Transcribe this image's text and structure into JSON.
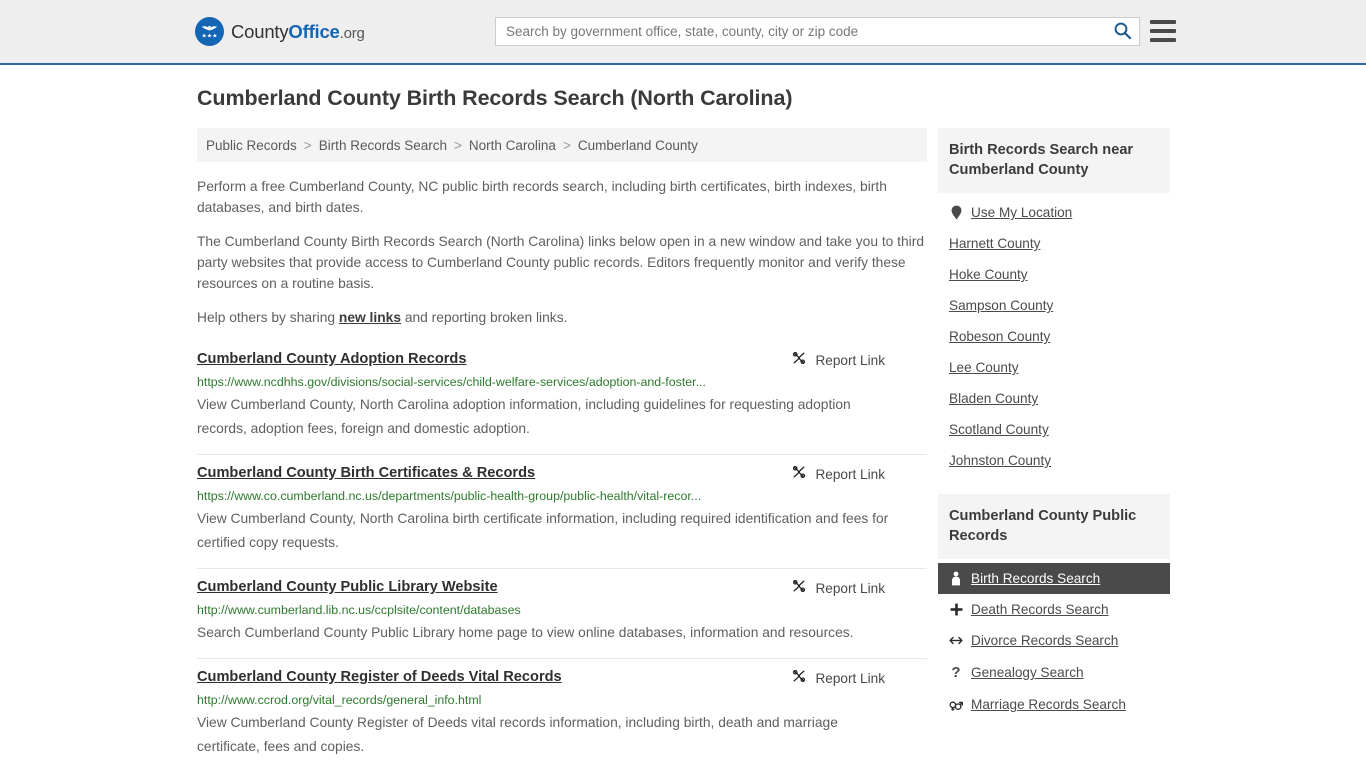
{
  "header": {
    "logo": {
      "text_1": "County",
      "text_2": "Office",
      "text_3": ".org",
      "icon": "eagle-seal-icon"
    },
    "search": {
      "placeholder": "Search by government office, state, county, city or zip code",
      "value": "",
      "button_icon": "search-icon"
    },
    "menu_icon": "hamburger-menu-icon",
    "accent_color": "#2b6ca3",
    "background_color": "#eeeeee"
  },
  "page": {
    "title": "Cumberland County Birth Records Search (North Carolina)"
  },
  "breadcrumb": {
    "items": [
      {
        "label": "Public Records",
        "is_current": false
      },
      {
        "label": "Birth Records Search",
        "is_current": false
      },
      {
        "label": "North Carolina",
        "is_current": false
      },
      {
        "label": "Cumberland County",
        "is_current": true
      }
    ],
    "separator": ">"
  },
  "intro": {
    "paragraph_1": "Perform a free Cumberland County, NC public birth records search, including birth certificates, birth indexes, birth databases, and birth dates.",
    "paragraph_2": "The Cumberland County Birth Records Search (North Carolina) links below open in a new window and take you to third party websites that provide access to Cumberland County public records. Editors frequently monitor and verify these resources on a routine basis.",
    "paragraph_3_before": "Help others by sharing ",
    "paragraph_3_link": "new links",
    "paragraph_3_after": " and reporting broken links."
  },
  "results": {
    "report_link_label": "Report Link",
    "report_link_icon": "broken-link-icon",
    "items": [
      {
        "title": "Cumberland County Adoption Records",
        "url": "https://www.ncdhhs.gov/divisions/social-services/child-welfare-services/adoption-and-foster...",
        "description": "View Cumberland County, North Carolina adoption information, including guidelines for requesting adoption records, adoption fees, foreign and domestic adoption."
      },
      {
        "title": "Cumberland County Birth Certificates & Records",
        "url": "https://www.co.cumberland.nc.us/departments/public-health-group/public-health/vital-recor...",
        "description": "View Cumberland County, North Carolina birth certificate information, including required identification and fees for certified copy requests."
      },
      {
        "title": "Cumberland County Public Library Website",
        "url": "http://www.cumberland.lib.nc.us/ccplsite/content/databases",
        "description": "Search Cumberland County Public Library home page to view online databases, information and resources."
      },
      {
        "title": "Cumberland County Register of Deeds Vital Records",
        "url": "http://www.ccrod.org/vital_records/general_info.html",
        "description": "View Cumberland County Register of Deeds vital records information, including birth, death and marriage certificate, fees and copies."
      }
    ]
  },
  "sidebar": {
    "nearby_panel": {
      "heading": "Birth Records Search near Cumberland County",
      "items": [
        {
          "label": "Use My Location",
          "icon": "map-pin-icon",
          "active": false
        },
        {
          "label": "Harnett County",
          "icon": "",
          "active": false
        },
        {
          "label": "Hoke County",
          "icon": "",
          "active": false
        },
        {
          "label": "Sampson County",
          "icon": "",
          "active": false
        },
        {
          "label": "Robeson County",
          "icon": "",
          "active": false
        },
        {
          "label": "Lee County",
          "icon": "",
          "active": false
        },
        {
          "label": "Bladen County",
          "icon": "",
          "active": false
        },
        {
          "label": "Scotland County",
          "icon": "",
          "active": false
        },
        {
          "label": "Johnston County",
          "icon": "",
          "active": false
        }
      ]
    },
    "records_panel": {
      "heading": "Cumberland County Public Records",
      "items": [
        {
          "label": "Birth Records Search",
          "icon": "baby-icon",
          "active": true
        },
        {
          "label": "Death Records Search",
          "icon": "cross-icon",
          "active": false
        },
        {
          "label": "Divorce Records Search",
          "icon": "double-arrow-icon",
          "active": false
        },
        {
          "label": "Genealogy Search",
          "icon": "question-mark-icon",
          "active": false
        },
        {
          "label": "Marriage Records Search",
          "icon": "gender-symbols-icon",
          "active": false
        }
      ]
    },
    "active_background_color": "#4a4a4a"
  }
}
